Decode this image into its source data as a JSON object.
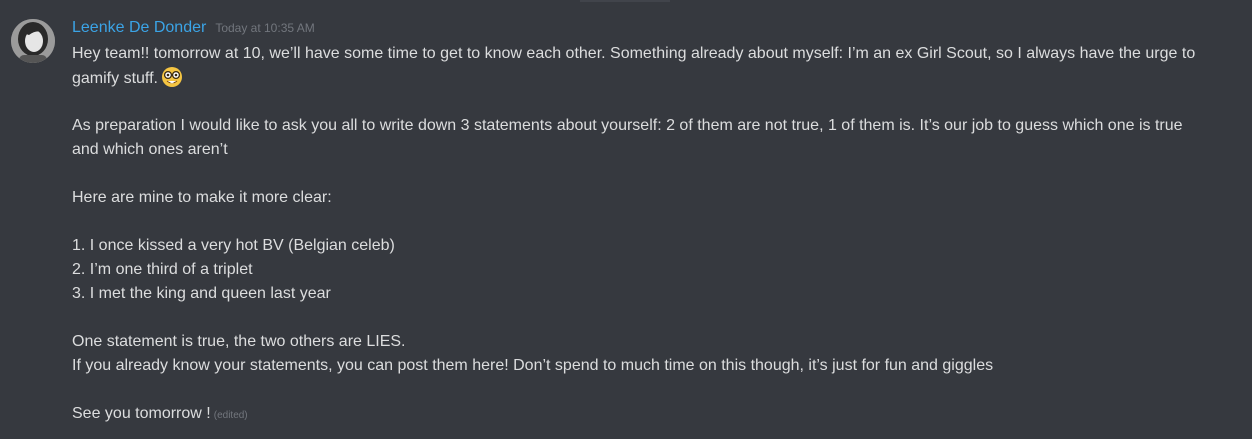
{
  "message": {
    "author": "Leenke De Donder",
    "timestamp": "Today at 10:35 AM",
    "avatar": "avatar",
    "lines": {
      "l1": "Hey team!! tomorrow at 10, we’ll have some time to get to know each other. Something already about myself: I’m an ex Girl Scout, so I always have the urge to",
      "l2": "gamify stuff.",
      "l3": "As preparation I would like to ask you all to write down 3 statements about yourself: 2 of them are not true, 1 of them is. It’s our job to guess which one is true",
      "l4": "and which ones aren’t",
      "l5": "Here are mine to make it more clear:",
      "l6": "1. I once kissed a very hot BV (Belgian celeb)",
      "l7": "2. I’m one third of a triplet",
      "l8": "3. I met the king and queen last year",
      "l9": "One statement is true, the two others are LIES.",
      "l10": "If you already know your statements, you can post them here! Don’t spend to much time on this though, it’s just for fun and giggles",
      "l11": "See you tomorrow !"
    },
    "emoji": "nerd-face-emoji",
    "edited_label": "(edited)"
  },
  "colors": {
    "background": "#36393f",
    "username": "#3ba4e6",
    "text": "#dcddde",
    "muted": "#72767d"
  }
}
